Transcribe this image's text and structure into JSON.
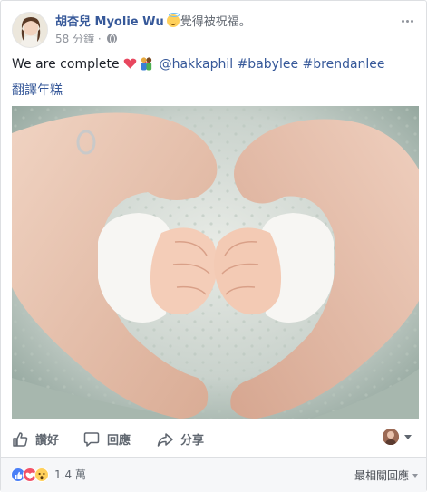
{
  "post": {
    "author": "胡杏兒 Myolie Wu",
    "feeling_icon": "smiling-face-with-halo",
    "feeling": "覺得被祝福。",
    "time": "58 分鐘",
    "separator": "·",
    "privacy_icon": "globe-icon",
    "text_start": "We are complete",
    "mention": "@hakkaphil",
    "hashtags": [
      "#babylee",
      "#brendanlee"
    ],
    "translate": "翻譯年糕",
    "photo_description": "hands forming a heart around baby fists"
  },
  "actions": {
    "like": "讚好",
    "comment": "回應",
    "share": "分享"
  },
  "footer": {
    "reaction_count": "1.4 萬",
    "sort_label": "最相關回應"
  },
  "colors": {
    "link": "#365899",
    "meta": "#90949c",
    "action_text": "#606770",
    "like": "#4a7ff7",
    "love": "#f25268",
    "wow": "#ffd05b"
  }
}
